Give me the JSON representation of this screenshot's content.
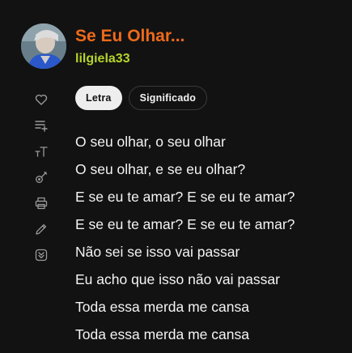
{
  "song": {
    "title": "Se Eu Olhar...",
    "artist": "lilgiela33"
  },
  "side_icons": [
    "heart-icon",
    "add-to-playlist-icon",
    "text-size-icon",
    "guitar-icon",
    "print-icon",
    "edit-icon",
    "scroll-down-icon"
  ],
  "tabs": [
    {
      "label": "Letra",
      "active": true
    },
    {
      "label": "Significado",
      "active": false
    }
  ],
  "lyrics": [
    "O seu olhar, o seu olhar",
    "O seu olhar, e se eu olhar?",
    "E se eu te amar? E se eu te amar?",
    "E se eu te amar? E se eu te amar?",
    "Não sei se isso vai passar",
    "Eu acho que isso não vai passar",
    "Toda essa merda me cansa",
    "Toda essa merda me cansa"
  ],
  "colors": {
    "accent": "#ef6a1a",
    "artist": "#b6d32a",
    "background": "#121212"
  }
}
